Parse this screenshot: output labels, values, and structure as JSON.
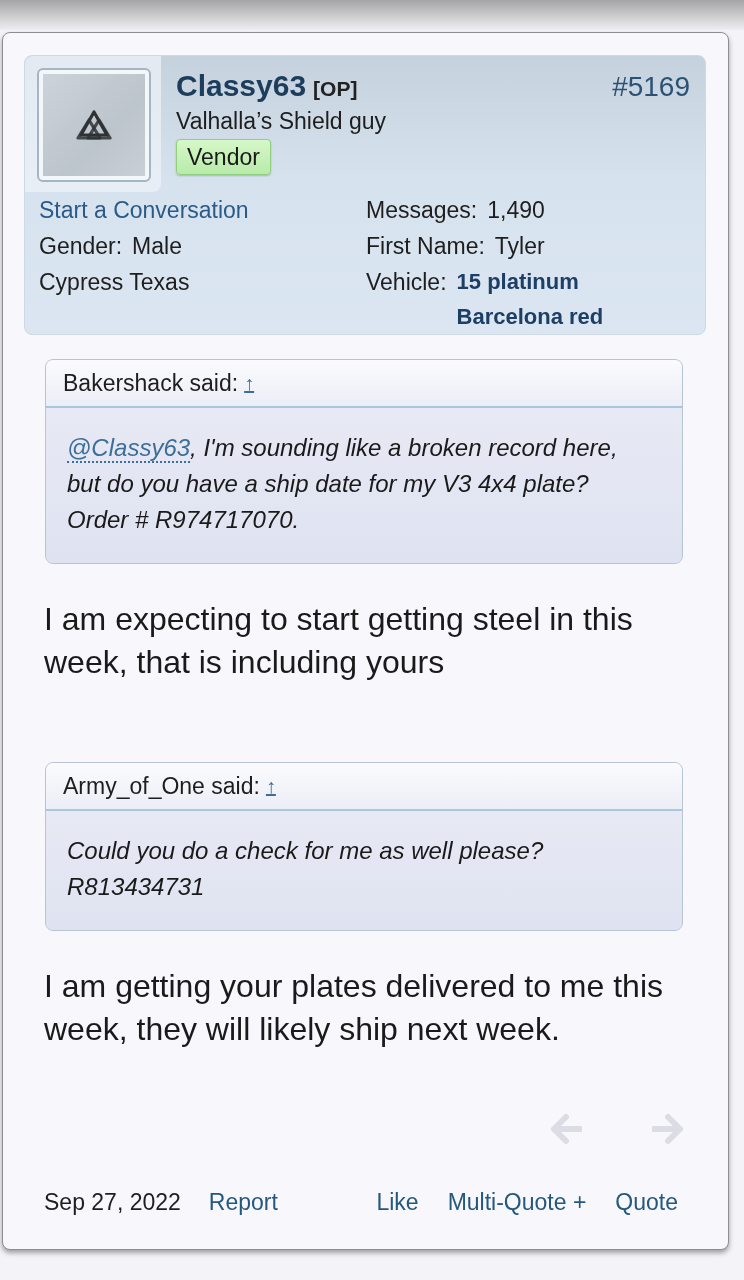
{
  "post": {
    "number": "#5169"
  },
  "author": {
    "name": "Classy63",
    "tag": "[OP]",
    "title": "Valhalla’s Shield guy",
    "badge": "Vendor",
    "left_fields": [
      {
        "kind": "link",
        "value": "Start a Conversation"
      },
      {
        "kind": "pair",
        "label": "Gender:",
        "value": "Male"
      },
      {
        "kind": "plain",
        "value": "Cypress Texas"
      }
    ],
    "right_fields": [
      {
        "kind": "pair",
        "label": "Messages:",
        "value": "1,490"
      },
      {
        "kind": "pair",
        "label": "First Name:",
        "value": "Tyler"
      },
      {
        "kind": "highlight",
        "label": "Vehicle:",
        "value": "15 platinum Barcelona red"
      }
    ]
  },
  "body": [
    {
      "kind": "quote",
      "author": "Bakershack said:",
      "jump": "↑",
      "mention": "@Classy63",
      "text": ", I'm sounding like a broken record here,\nbut do you have a ship date for my V3 4x4 plate?\nOrder # R974717070."
    },
    {
      "kind": "text",
      "text": "I am expecting to start getting steel in this week, that is including yours"
    },
    {
      "kind": "quote",
      "author": "Army_of_One said:",
      "jump": "↑",
      "text": "Could you do a check for me as well please?\nR813434731"
    },
    {
      "kind": "text",
      "text": "I am getting your plates delivered to me this week, they will likely ship next week."
    }
  ],
  "footer": {
    "date": "Sep 27, 2022",
    "report": "Report",
    "actions": [
      "Like",
      "Multi-Quote +",
      "Quote"
    ]
  }
}
